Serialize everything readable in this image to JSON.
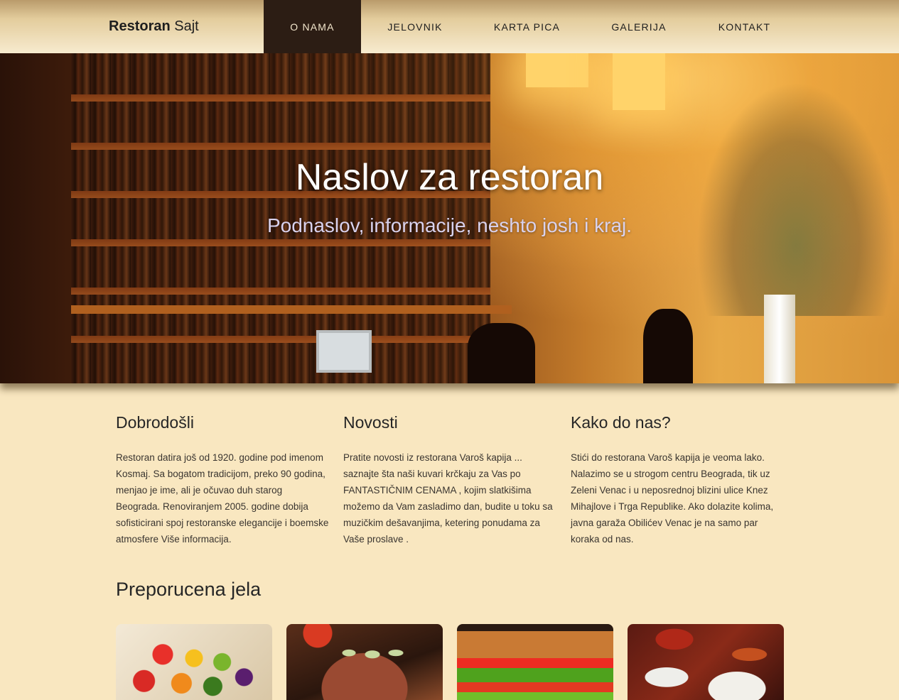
{
  "navbar": {
    "brand_bold": "Restoran",
    "brand_light": " Sajt",
    "items": [
      {
        "label": "O NAMA",
        "active": true
      },
      {
        "label": "JELOVNIK",
        "active": false
      },
      {
        "label": "KARTA PICA",
        "active": false
      },
      {
        "label": "GALERIJA",
        "active": false
      },
      {
        "label": "KONTAKT",
        "active": false
      }
    ]
  },
  "hero": {
    "title": "Naslov za restoran",
    "subtitle": "Podnaslov, informacije, neshto josh i kraj."
  },
  "columns": [
    {
      "heading": "Dobrodošli",
      "text": "Restoran datira još od 1920. godine pod imenom Kosmaj. Sa bogatom tradicijom, preko 90 godina, menjao je ime, ali je očuvao duh starog Beograda. Renoviranjem 2005. godine dobija sofisticirani spoj restoranske elegancije i boemske atmosfere Više informacija."
    },
    {
      "heading": "Novosti",
      "text": "Pratite novosti iz restorana Varoš kapija ... saznajte šta naši kuvari krčkaju za Vas po FANTASTIČNIM CENAMA , kojim slatkišima možemo da Vam zasladimo dan, budite u toku sa muzičkim dešavanjima, ketering ponudama za Vaše proslave ."
    },
    {
      "heading": "Kako do nas?",
      "text": "Stići do restorana Varoš kapija je veoma lako. Nalazimo se u strogom centru Beograda, tik uz Zeleni Venac i u neposrednoj blizini ulice Knez Mihajlove i Trga Republike. Ako dolazite kolima, javna garaža Obilićev Venac je na samo par koraka od nas."
    }
  ],
  "featured": {
    "title": "Preporucena jela",
    "cards": [
      {
        "image": "fruit-skewers-photo"
      },
      {
        "image": "pizza-photo"
      },
      {
        "image": "sandwich-photo"
      },
      {
        "image": "seafood-plates-photo"
      }
    ]
  },
  "colors": {
    "background": "#f9e7c0",
    "nav_active": "#2c1d14",
    "nav_gradient_top": "#b99b6b",
    "nav_gradient_bottom": "#f7ebcf"
  }
}
